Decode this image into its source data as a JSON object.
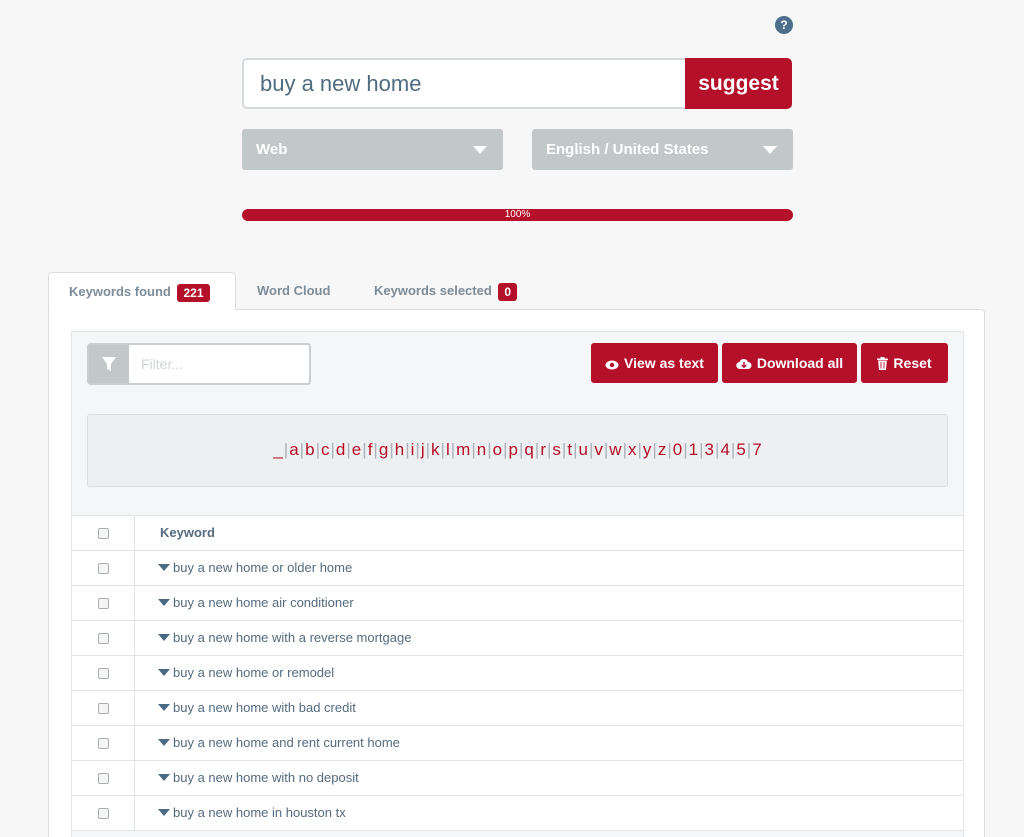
{
  "help": {
    "label": "?"
  },
  "search": {
    "value": "buy a new home",
    "button_label": "suggest"
  },
  "selects": {
    "source": "Web",
    "language": "English / United States"
  },
  "progress": {
    "label": "100%",
    "value": 100
  },
  "tabs": [
    {
      "label": "Keywords found",
      "badge": "221"
    },
    {
      "label": "Word Cloud"
    },
    {
      "label": "Keywords selected",
      "badge": "0"
    }
  ],
  "toolbar": {
    "filter_placeholder": "Filter...",
    "view_as_text": "View as text",
    "download_all": "Download all",
    "reset": "Reset"
  },
  "letters": [
    "_",
    "a",
    "b",
    "c",
    "d",
    "e",
    "f",
    "g",
    "h",
    "i",
    "j",
    "k",
    "l",
    "m",
    "n",
    "o",
    "p",
    "q",
    "r",
    "s",
    "t",
    "u",
    "v",
    "w",
    "x",
    "y",
    "z",
    "0",
    "1",
    "3",
    "4",
    "5",
    "7"
  ],
  "table": {
    "header": "Keyword",
    "rows": [
      "buy a new home or older home",
      "buy a new home air conditioner",
      "buy a new home with a reverse mortgage",
      "buy a new home or remodel",
      "buy a new home with bad credit",
      "buy a new home and rent current home",
      "buy a new home with no deposit",
      "buy a new home in houston tx"
    ]
  },
  "colors": {
    "accent": "#b4102a",
    "select_bg": "#c2c7ca",
    "text": "#546b7f"
  }
}
